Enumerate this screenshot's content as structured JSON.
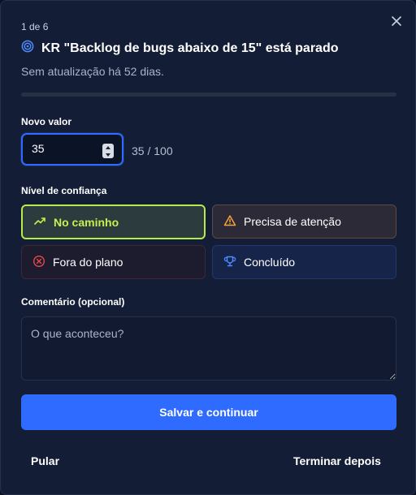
{
  "step": "1 de 6",
  "title": "KR \"Backlog de bugs abaixo de 15\" está parado",
  "subtitle": "Sem atualização há 52 dias.",
  "progress_fraction": 0.0,
  "new_value": {
    "label": "Novo valor",
    "value": "35",
    "target": "35 / 100"
  },
  "confidence": {
    "label": "Nível de confiança",
    "options": [
      {
        "label": "No caminho",
        "selected": true,
        "icon": "trend-up-icon"
      },
      {
        "label": "Precisa de atenção",
        "selected": false,
        "icon": "warning-triangle-icon"
      },
      {
        "label": "Fora do plano",
        "selected": false,
        "icon": "x-circle-icon"
      },
      {
        "label": "Concluído",
        "selected": false,
        "icon": "trophy-icon"
      }
    ]
  },
  "comment": {
    "label": "Comentário (opcional)",
    "placeholder": "O que aconteceu?"
  },
  "actions": {
    "save": "Salvar e continuar",
    "skip": "Pular",
    "later": "Terminar depois"
  },
  "colors": {
    "accent": "#2f6bff",
    "on_track": "#b7ea4a",
    "attention": "#f5a23c",
    "off_track": "#e5484d",
    "done": "#4f8bff"
  }
}
